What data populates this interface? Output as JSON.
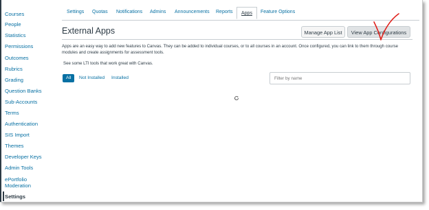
{
  "sidebar": {
    "items": [
      {
        "label": "Courses"
      },
      {
        "label": "People"
      },
      {
        "label": "Statistics"
      },
      {
        "label": "Permissions"
      },
      {
        "label": "Outcomes"
      },
      {
        "label": "Rubrics"
      },
      {
        "label": "Grading"
      },
      {
        "label": "Question Banks"
      },
      {
        "label": "Sub-Accounts"
      },
      {
        "label": "Terms"
      },
      {
        "label": "Authentication"
      },
      {
        "label": "SIS Import"
      },
      {
        "label": "Themes"
      },
      {
        "label": "Developer Keys"
      },
      {
        "label": "Admin Tools"
      },
      {
        "label": "ePortfolio"
      },
      {
        "label": "Moderation"
      },
      {
        "label": "Settings"
      }
    ]
  },
  "tabs": [
    {
      "label": "Settings"
    },
    {
      "label": "Quotas"
    },
    {
      "label": "Notifications"
    },
    {
      "label": "Admins"
    },
    {
      "label": "Announcements"
    },
    {
      "label": "Reports"
    },
    {
      "label": "Apps"
    },
    {
      "label": "Feature Options"
    }
  ],
  "header": {
    "title": "External Apps",
    "manage_label": "Manage App List",
    "view_label": "View App Configurations"
  },
  "description": {
    "line1": "Apps are an easy way to add new features to Canvas. They can be added to individual courses, or to all courses in an account. Once configured, you can link to them through course",
    "line2": "modules and create assignments for assessment tools."
  },
  "tools_text": "See some LTI tools that work great with Canvas.",
  "filters": {
    "all": "All",
    "not_installed": "Not Installed",
    "installed": "Installed"
  },
  "search": {
    "placeholder": "Filter by name"
  },
  "icons": {
    "loading": "refresh-spinner-icon",
    "annotation": "red-checkmark-icon"
  },
  "colors": {
    "link": "#0770a3",
    "text": "#2d3b45",
    "annotation": "#e0201b"
  }
}
